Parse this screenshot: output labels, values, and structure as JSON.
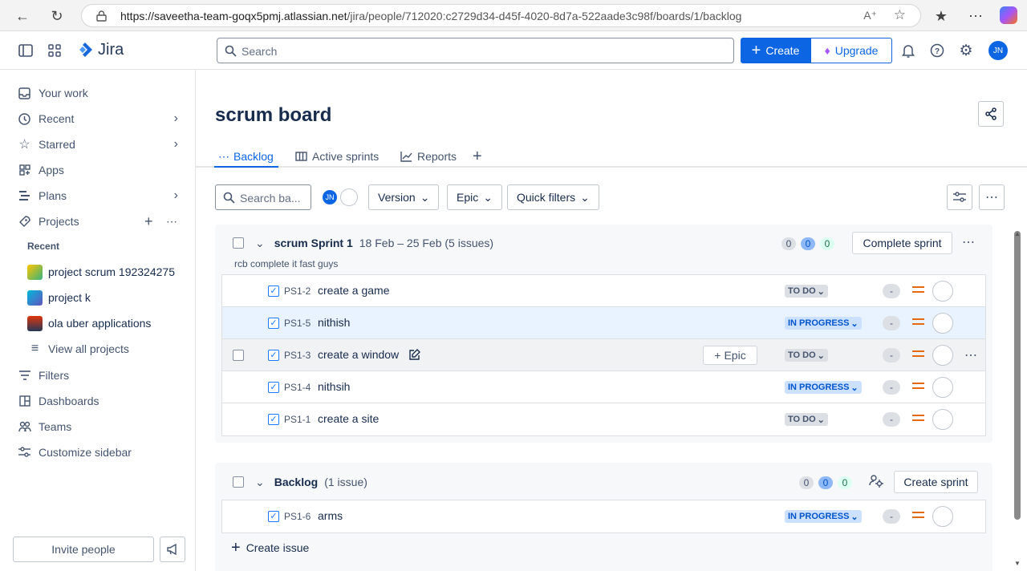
{
  "browser": {
    "url_host": "https://saveetha-team-goqx5pmj.atlassian.net",
    "url_path": "/jira/people/712020:c2729d34-d45f-4020-8d7a-522aade3c98f/boards/1/backlog"
  },
  "topbar": {
    "logo": "Jira",
    "search_placeholder": "Search",
    "create_label": "Create",
    "upgrade_label": "Upgrade",
    "avatar": "JN"
  },
  "sidebar": {
    "items": [
      {
        "label": "Your work",
        "icon": "your-work-icon"
      },
      {
        "label": "Recent",
        "icon": "clock-icon",
        "chevron": true
      },
      {
        "label": "Starred",
        "icon": "star-icon",
        "chevron": true
      },
      {
        "label": "Apps",
        "icon": "apps-icon"
      },
      {
        "label": "Plans",
        "icon": "plans-icon",
        "chevron": true
      },
      {
        "label": "Projects",
        "icon": "rocket-icon"
      }
    ],
    "recent_header": "Recent",
    "projects": [
      "project scrum 192324275",
      "project k",
      "ola uber applications"
    ],
    "view_all": "View all projects",
    "bottom_items": [
      "Filters",
      "Dashboards",
      "Teams",
      "Customize sidebar"
    ],
    "invite": "Invite people"
  },
  "board": {
    "title": "scrum board",
    "tabs": [
      "Backlog",
      "Active sprints",
      "Reports"
    ],
    "search_placeholder": "Search ba...",
    "avatar": "JN",
    "filters": [
      "Version",
      "Epic",
      "Quick filters"
    ]
  },
  "sprint": {
    "name": "scrum Sprint 1",
    "dates": "18 Feb – 25 Feb (5 issues)",
    "goal": "rcb complete it fast guys",
    "counts": [
      "0",
      "0",
      "0"
    ],
    "action": "Complete sprint",
    "issues": [
      {
        "key": "PS1-2",
        "summary": "create a game",
        "status": "TO DO",
        "est": "-"
      },
      {
        "key": "PS1-5",
        "summary": "nithish",
        "status": "IN PROGRESS",
        "est": "-"
      },
      {
        "key": "PS1-3",
        "summary": "create a window",
        "status": "TO DO",
        "est": "-",
        "epic": "Epic"
      },
      {
        "key": "PS1-4",
        "summary": "nithsih",
        "status": "IN PROGRESS",
        "est": "-"
      },
      {
        "key": "PS1-1",
        "summary": "create a site",
        "status": "TO DO",
        "est": "-"
      }
    ]
  },
  "backlog": {
    "name": "Backlog",
    "count": "(1 issue)",
    "counts": [
      "0",
      "0",
      "0"
    ],
    "action": "Create sprint",
    "issues": [
      {
        "key": "PS1-6",
        "summary": "arms",
        "status": "IN PROGRESS",
        "est": "-"
      }
    ],
    "create_issue": "Create issue"
  }
}
